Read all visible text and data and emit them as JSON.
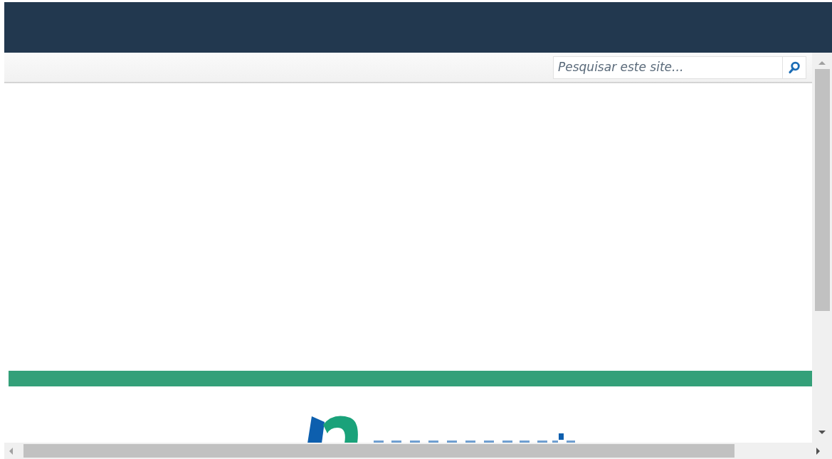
{
  "search": {
    "placeholder": "Pesquisar este site..."
  }
}
